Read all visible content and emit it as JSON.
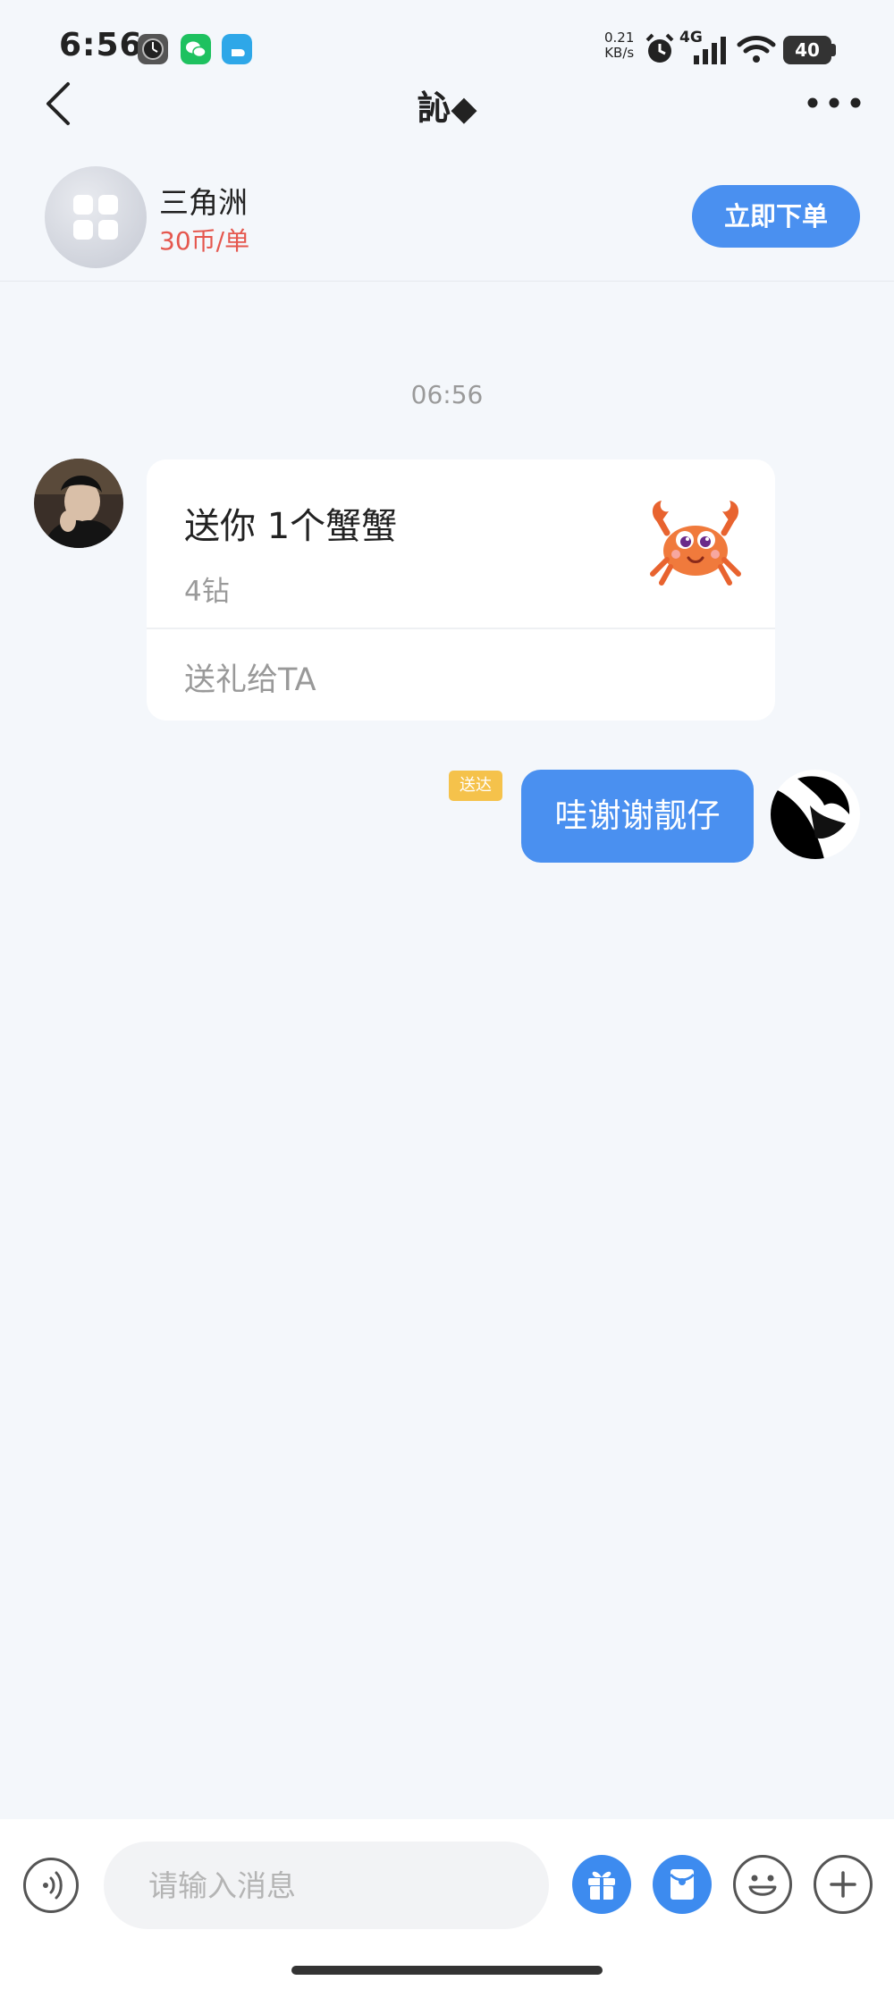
{
  "status_bar": {
    "time": "6:56",
    "net_speed_value": "0.21",
    "net_speed_unit": "KB/s",
    "network": "4G",
    "battery": "40",
    "icons": [
      "clock-app-icon",
      "wechat-icon",
      "app-icon",
      "alarm-icon",
      "signal-icon",
      "wifi-icon",
      "battery-icon"
    ]
  },
  "nav": {
    "title": "訫◆",
    "back_icon": "chevron-left-icon",
    "more_icon": "more-horizontal-icon"
  },
  "service": {
    "name": "三角洲",
    "price": "30币/单",
    "order_button": "立即下单",
    "icon": "grid-apps-icon"
  },
  "chat": {
    "timestamp": "06:56",
    "messages": [
      {
        "side": "left",
        "type": "gift",
        "gift_title": "送你 1个蟹蟹",
        "gift_price": "4钻",
        "gift_action": "送礼给TA",
        "gift_image": "crab-icon"
      },
      {
        "side": "right",
        "type": "text",
        "text": "哇谢谢靓仔",
        "status": "送达"
      }
    ]
  },
  "input_bar": {
    "placeholder": "请输入消息",
    "buttons": [
      "voice-icon",
      "gift-icon",
      "red-packet-icon",
      "emoji-icon",
      "plus-icon"
    ]
  },
  "colors": {
    "accent": "#4a90f0",
    "price": "#e5574e",
    "badge": "#f5c24b",
    "background": "#f4f7fb"
  }
}
